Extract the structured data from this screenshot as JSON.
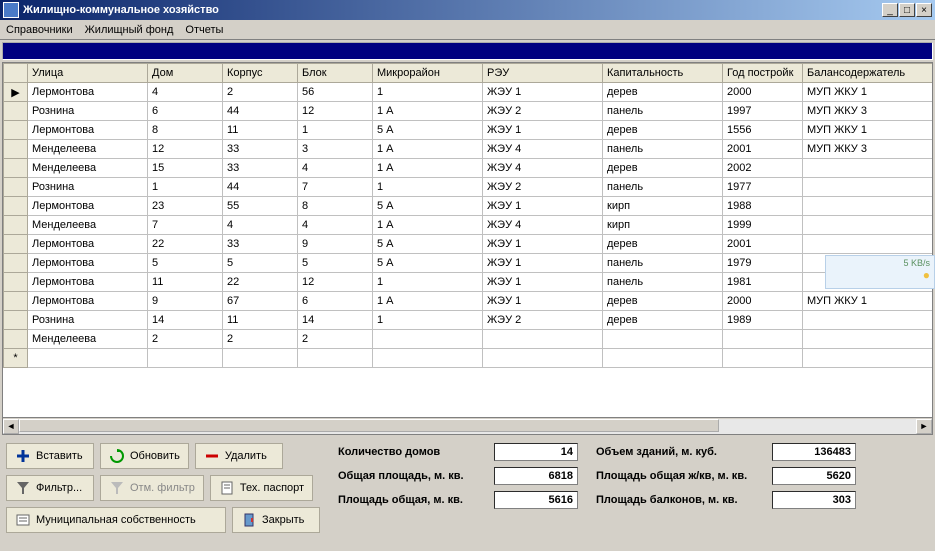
{
  "window": {
    "title": "Жилищно-коммунальное хозяйство"
  },
  "menu": {
    "m1": "Справочники",
    "m2": "Жилищный фонд",
    "m3": "Отчеты"
  },
  "columns": {
    "street": "Улица",
    "house": "Дом",
    "korpus": "Корпус",
    "block": "Блок",
    "micro": "Микрорайон",
    "reu": "РЭУ",
    "kap": "Капитальность",
    "year": "Год постройк",
    "bal": "Балансодержатель"
  },
  "rows": [
    {
      "m": "▶",
      "street": "Лермонтова",
      "house": "4",
      "korpus": "2",
      "block": "56",
      "micro": "1",
      "reu": "ЖЭУ 1",
      "kap": "дерев",
      "year": "2000",
      "bal": "МУП ЖКУ 1"
    },
    {
      "m": "",
      "street": "Рознина",
      "house": "6",
      "korpus": "44",
      "block": "12",
      "micro": "1 А",
      "reu": "ЖЭУ 2",
      "kap": "панель",
      "year": "1997",
      "bal": "МУП ЖКУ 3"
    },
    {
      "m": "",
      "street": "Лермонтова",
      "house": "8",
      "korpus": "11",
      "block": "1",
      "micro": "5 А",
      "reu": "ЖЭУ 1",
      "kap": "дерев",
      "year": "1556",
      "bal": "МУП ЖКУ 1"
    },
    {
      "m": "",
      "street": "Менделеева",
      "house": "12",
      "korpus": "33",
      "block": "3",
      "micro": "1 А",
      "reu": "ЖЭУ 4",
      "kap": "панель",
      "year": "2001",
      "bal": "МУП ЖКУ 3"
    },
    {
      "m": "",
      "street": "Менделеева",
      "house": "15",
      "korpus": "33",
      "block": "4",
      "micro": "1 А",
      "reu": "ЖЭУ 4",
      "kap": "дерев",
      "year": "2002",
      "bal": ""
    },
    {
      "m": "",
      "street": "Рознина",
      "house": "1",
      "korpus": "44",
      "block": "7",
      "micro": "1",
      "reu": "ЖЭУ 2",
      "kap": "панель",
      "year": "1977",
      "bal": ""
    },
    {
      "m": "",
      "street": "Лермонтова",
      "house": "23",
      "korpus": "55",
      "block": "8",
      "micro": "5 А",
      "reu": "ЖЭУ 1",
      "kap": "кирп",
      "year": "1988",
      "bal": ""
    },
    {
      "m": "",
      "street": "Менделеева",
      "house": "7",
      "korpus": "4",
      "block": "4",
      "micro": "1 А",
      "reu": "ЖЭУ 4",
      "kap": "кирп",
      "year": "1999",
      "bal": ""
    },
    {
      "m": "",
      "street": "Лермонтова",
      "house": "22",
      "korpus": "33",
      "block": "9",
      "micro": "5 А",
      "reu": "ЖЭУ 1",
      "kap": "дерев",
      "year": "2001",
      "bal": ""
    },
    {
      "m": "",
      "street": "Лермонтова",
      "house": "5",
      "korpus": "5",
      "block": "5",
      "micro": "5 А",
      "reu": "ЖЭУ 1",
      "kap": "панель",
      "year": "1979",
      "bal": ""
    },
    {
      "m": "",
      "street": "Лермонтова",
      "house": "11",
      "korpus": "22",
      "block": "12",
      "micro": "1",
      "reu": "ЖЭУ 1",
      "kap": "панель",
      "year": "1981",
      "bal": ""
    },
    {
      "m": "",
      "street": "Лермонтова",
      "house": "9",
      "korpus": "67",
      "block": "6",
      "micro": "1 А",
      "reu": "ЖЭУ 1",
      "kap": "дерев",
      "year": "2000",
      "bal": "МУП ЖКУ 1"
    },
    {
      "m": "",
      "street": "Рознина",
      "house": "14",
      "korpus": "11",
      "block": "14",
      "micro": "1",
      "reu": "ЖЭУ 2",
      "kap": "дерев",
      "year": "1989",
      "bal": ""
    },
    {
      "m": "",
      "street": "Менделеева",
      "house": "2",
      "korpus": "2",
      "block": "2",
      "micro": "",
      "reu": "",
      "kap": "",
      "year": "",
      "bal": ""
    },
    {
      "m": "*",
      "street": "",
      "house": "",
      "korpus": "",
      "block": "",
      "micro": "",
      "reu": "",
      "kap": "",
      "year": "",
      "bal": ""
    }
  ],
  "buttons": {
    "insert": "Вставить",
    "refresh": "Обновить",
    "delete": "Удалить",
    "filter": "Фильтр...",
    "cancel_filter": "Отм. фильтр",
    "tech_passport": "Тех. паспорт",
    "municipal": "Муниципальная собственность",
    "close": "Закрыть"
  },
  "stats": {
    "house_count_label": "Количество домов",
    "house_count": "14",
    "volume_label": "Объем зданий, м. куб.",
    "volume": "136483",
    "total_area_label": "Общая площадь, м. кв.",
    "total_area": "6818",
    "living_area_label": "Площадь общая ж/кв, м. кв.",
    "living_area": "5620",
    "total_area2_label": "Площадь общая, м. кв.",
    "total_area2": "5616",
    "balcony_label": "Площадь балконов, м. кв.",
    "balcony": "303"
  },
  "overlay": {
    "text": "5 KB/s"
  }
}
